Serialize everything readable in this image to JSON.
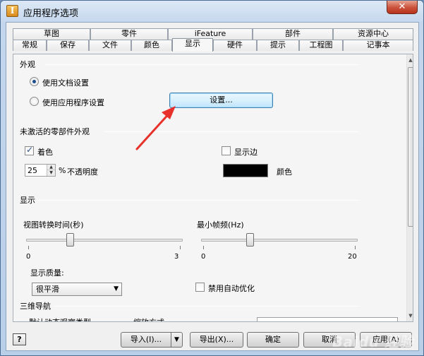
{
  "window": {
    "title": "应用程序选项",
    "app_icon_glyph": "I",
    "close_glyph": "✕"
  },
  "tabs": {
    "row_back": [
      "草图",
      "零件",
      "iFeature",
      "部件",
      "资源中心"
    ],
    "row_front": [
      "常规",
      "保存",
      "文件",
      "颜色",
      "显示",
      "硬件",
      "提示",
      "工程图",
      "记事本"
    ],
    "active": "显示"
  },
  "appearance": {
    "section_title": "外观",
    "option_document": "使用文档设置",
    "option_application": "使用应用程序设置",
    "selected": "使用文档设置",
    "settings_button": "设置..."
  },
  "inactive": {
    "section_title": "未激活的零部件外观",
    "shading_label": "着色",
    "shading_checked": true,
    "show_edges_label": "显示边",
    "show_edges_checked": false,
    "opacity_value": "25",
    "opacity_unit": "%",
    "opacity_label": "不透明度",
    "color_label": "颜色",
    "color_value": "#000000"
  },
  "display": {
    "section_title": "显示",
    "view_transition_label": "视图转换时间(秒)",
    "view_transition_min": "0",
    "view_transition_max": "3",
    "view_transition_value": 0.8,
    "min_fps_label": "最小帧频(Hz)",
    "min_fps_min": "0",
    "min_fps_max": "20",
    "min_fps_value": 6,
    "quality_label": "显示质量:",
    "quality_value": "很平滑",
    "disable_auto_opt_label": "禁用自动优化",
    "disable_auto_opt_checked": false
  },
  "nav3d": {
    "section_title": "三维导航",
    "cut_label_1": "默认动态观察类型",
    "cut_label_2": "缩放方式"
  },
  "footer": {
    "help_glyph": "?",
    "import_label": "导入(I)...",
    "export_label": "导出(X)...",
    "ok_label": "确定",
    "cancel_label": "取消",
    "apply_label": "应用(A)"
  },
  "watermark": "Baidu 经验",
  "colors": {
    "annotation_arrow": "#e8312a",
    "title_bar": "#c6d8ee",
    "close_button": "#c9513b"
  }
}
